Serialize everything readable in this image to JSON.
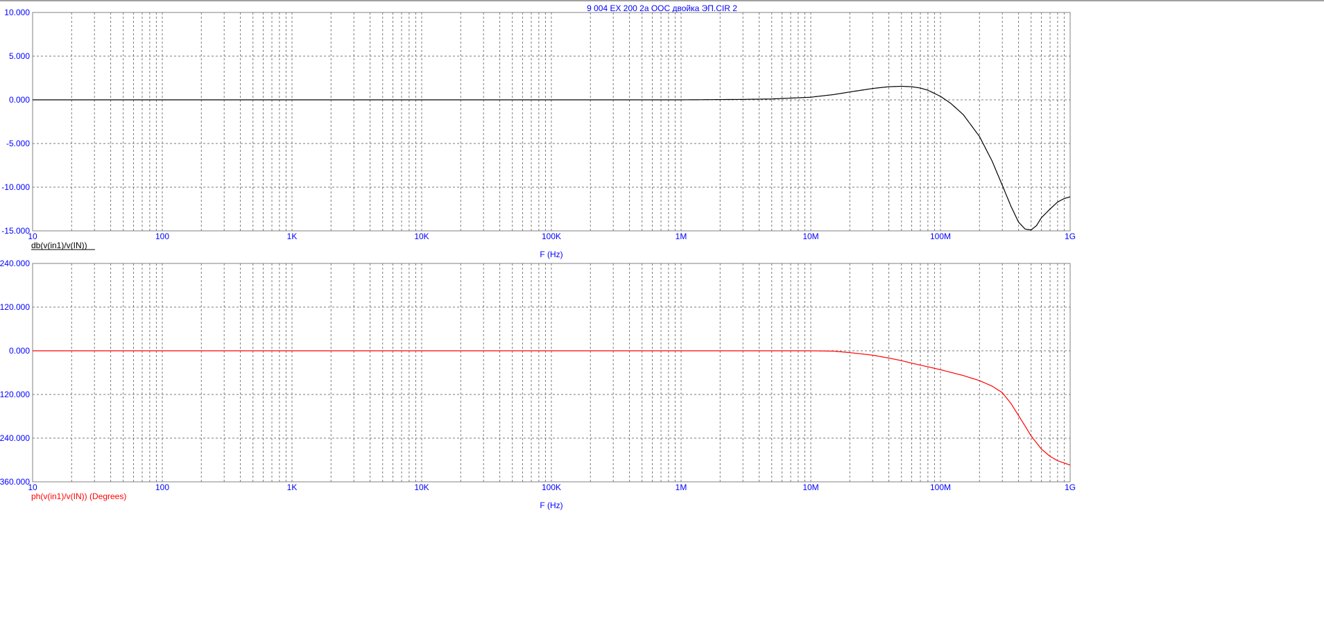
{
  "title": "9 004 EX 200 2a ООС двойка ЭП.CIR 2",
  "colors": {
    "axis_text": "#0000ff",
    "grid": "#7a7a7a",
    "frame": "#808080"
  },
  "chart_data": [
    {
      "type": "line",
      "x_scale": "log",
      "xlim": [
        10,
        1000000000
      ],
      "ylim": [
        -15,
        10
      ],
      "x_ticks": [
        {
          "value": 10,
          "label": "10"
        },
        {
          "value": 100,
          "label": "100"
        },
        {
          "value": 1000,
          "label": "1K"
        },
        {
          "value": 10000,
          "label": "10K"
        },
        {
          "value": 100000,
          "label": "100K"
        },
        {
          "value": 1000000,
          "label": "1M"
        },
        {
          "value": 10000000,
          "label": "10M"
        },
        {
          "value": 100000000,
          "label": "100M"
        },
        {
          "value": 1000000000,
          "label": "1G"
        }
      ],
      "y_ticks": [
        {
          "value": 10,
          "label": "10.000"
        },
        {
          "value": 5,
          "label": "5.000"
        },
        {
          "value": 0,
          "label": "0.000"
        },
        {
          "value": -5,
          "label": "-5.000"
        },
        {
          "value": -10,
          "label": "-10.000"
        },
        {
          "value": -15,
          "label": "-15.000"
        }
      ],
      "xlabel": "F (Hz)",
      "grid": true,
      "series": [
        {
          "name": "db(v(in1)/v(IN))",
          "color": "#000000",
          "x": [
            10,
            100000,
            1000000,
            3000000,
            5000000,
            10000000,
            15000000,
            20000000,
            30000000,
            40000000,
            50000000,
            60000000,
            70000000,
            80000000,
            100000000,
            120000000,
            150000000,
            200000000,
            250000000,
            300000000,
            350000000,
            400000000,
            450000000,
            500000000,
            550000000,
            600000000,
            700000000,
            800000000,
            900000000,
            1000000000
          ],
          "y": [
            0,
            0,
            0,
            0.05,
            0.1,
            0.3,
            0.6,
            0.9,
            1.3,
            1.5,
            1.55,
            1.5,
            1.35,
            1.1,
            0.4,
            -0.4,
            -1.7,
            -4.2,
            -7.0,
            -9.8,
            -12.2,
            -14.0,
            -14.8,
            -14.9,
            -14.4,
            -13.5,
            -12.5,
            -11.7,
            -11.3,
            -11.1
          ]
        }
      ]
    },
    {
      "type": "line",
      "x_scale": "log",
      "xlim": [
        10,
        1000000000
      ],
      "ylim": [
        -360,
        240
      ],
      "x_ticks": [
        {
          "value": 10,
          "label": "10"
        },
        {
          "value": 100,
          "label": "100"
        },
        {
          "value": 1000,
          "label": "1K"
        },
        {
          "value": 10000,
          "label": "10K"
        },
        {
          "value": 100000,
          "label": "100K"
        },
        {
          "value": 1000000,
          "label": "1M"
        },
        {
          "value": 10000000,
          "label": "10M"
        },
        {
          "value": 100000000,
          "label": "100M"
        },
        {
          "value": 1000000000,
          "label": "1G"
        }
      ],
      "y_ticks": [
        {
          "value": 240,
          "label": "240.000"
        },
        {
          "value": 120,
          "label": "120.000"
        },
        {
          "value": 0,
          "label": "0.000"
        },
        {
          "value": -120,
          "label": "-120.000"
        },
        {
          "value": -240,
          "label": "-240.000"
        },
        {
          "value": -360,
          "label": "-360.000"
        }
      ],
      "xlabel": "F (Hz)",
      "grid": true,
      "series": [
        {
          "name": "ph(v(in1)/v(IN)) (Degrees)",
          "color": "#ff0000",
          "x": [
            10,
            1000000,
            10000000,
            15000000,
            20000000,
            30000000,
            40000000,
            50000000,
            60000000,
            80000000,
            100000000,
            150000000,
            200000000,
            250000000,
            300000000,
            350000000,
            400000000,
            450000000,
            500000000,
            600000000,
            700000000,
            800000000,
            1000000000
          ],
          "y": [
            0,
            0,
            0,
            -1,
            -5,
            -12,
            -20,
            -27,
            -34,
            -44,
            -52,
            -68,
            -82,
            -97,
            -115,
            -145,
            -178,
            -207,
            -234,
            -270,
            -290,
            -302,
            -314
          ]
        }
      ]
    }
  ]
}
